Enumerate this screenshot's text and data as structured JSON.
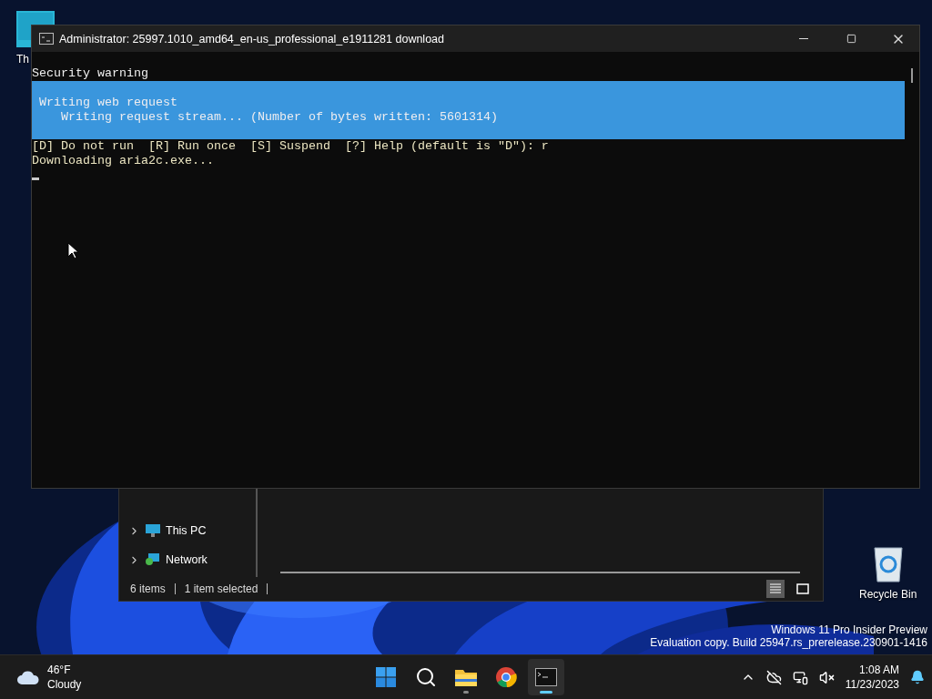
{
  "desktop_icons": [
    {
      "kind": "monitor",
      "label": "Th"
    },
    {
      "kind": "recycle",
      "label": "Recycle Bin"
    }
  ],
  "terminal": {
    "title": "Administrator:  25997.1010_amd64_en-us_professional_e1911281 download",
    "blocks": [
      {
        "kind": "text",
        "color": "#f0f0f0",
        "text": "Security warning"
      },
      {
        "kind": "progress",
        "activity": "Writing web request",
        "status": "Writing request stream... (Number of bytes written: 5601314)"
      },
      {
        "kind": "text",
        "color": "#ece6c2",
        "text": "[D] Do not run  [R] Run once  [S] Suspend  [?] Help (default is \"D\"): r"
      },
      {
        "kind": "text",
        "color": "#ece6c2",
        "text": "Downloading aria2c.exe..."
      }
    ]
  },
  "explorer": {
    "nav_items": [
      {
        "kind": "pc",
        "label": "This PC",
        "expanded": false
      },
      {
        "kind": "network",
        "label": "Network",
        "expanded": false
      }
    ],
    "status": [
      "6 items",
      "1 item selected"
    ],
    "views": [
      {
        "kind": "details",
        "selected": true
      },
      {
        "kind": "tiles",
        "selected": false
      }
    ]
  },
  "edition_notice": [
    "Windows 11 Pro Insider Preview",
    "Evaluation copy. Build 25947.rs_prerelease.230901-1416"
  ],
  "taskbar": {
    "weather": {
      "temperature": "46°F",
      "condition": "Cloudy"
    },
    "apps": [
      {
        "kind": "start",
        "active": false
      },
      {
        "kind": "search",
        "active": false
      },
      {
        "kind": "explorer",
        "active": false
      },
      {
        "kind": "browser",
        "active": false
      },
      {
        "kind": "terminal",
        "active": true
      }
    ],
    "clock": {
      "time": "1:08 AM",
      "date": "11/23/2023"
    }
  }
}
